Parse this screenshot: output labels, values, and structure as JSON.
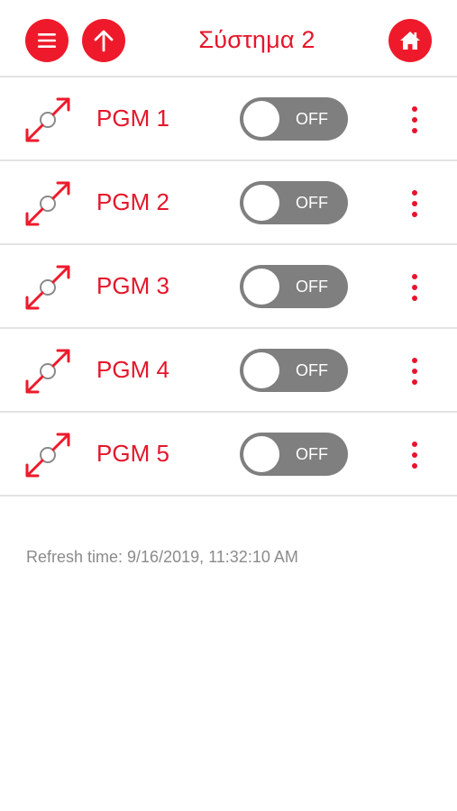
{
  "header": {
    "title": "Σύστημα 2",
    "menu_icon": "hamburger-menu-icon",
    "up_icon": "arrow-up-icon",
    "home_icon": "home-icon"
  },
  "pgm_list": [
    {
      "label": "PGM 1",
      "state": "OFF",
      "icon": "pgm-output-icon"
    },
    {
      "label": "PGM 2",
      "state": "OFF",
      "icon": "pgm-output-icon"
    },
    {
      "label": "PGM 3",
      "state": "OFF",
      "icon": "pgm-output-icon"
    },
    {
      "label": "PGM 4",
      "state": "OFF",
      "icon": "pgm-output-icon"
    },
    {
      "label": "PGM 5",
      "state": "OFF",
      "icon": "pgm-output-icon"
    }
  ],
  "refresh_text": "Refresh time: 9/16/2019, 11:32:10 AM",
  "colors": {
    "accent": "#ee1a2b",
    "text_accent": "#e5162a",
    "toggle_off": "#7f7f7f",
    "divider": "#e3e3e3",
    "muted_text": "#8b8b8b"
  }
}
